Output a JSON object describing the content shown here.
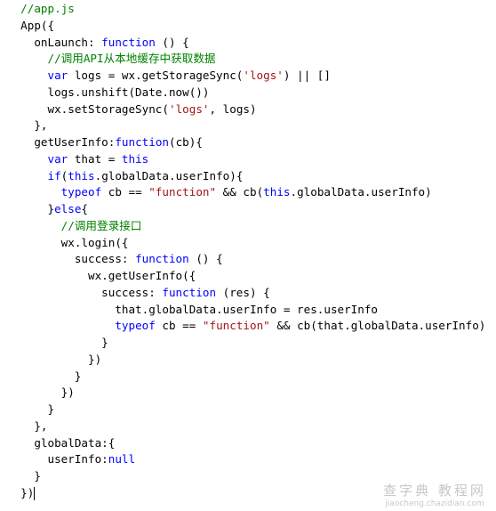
{
  "colors": {
    "keyword": "#0000ff",
    "string": "#a31515",
    "comment": "#008000",
    "plain": "#000000"
  },
  "code_lines": [
    [
      [
        "cm",
        "  //app.js"
      ]
    ],
    [
      [
        "pl",
        "  App({"
      ]
    ],
    [
      [
        "pl",
        "    onLaunch: "
      ],
      [
        "kw",
        "function"
      ],
      [
        "pl",
        " () {"
      ]
    ],
    [
      [
        "cm",
        "      //调用API从本地缓存中获取数据"
      ]
    ],
    [
      [
        "pl",
        "      "
      ],
      [
        "kw",
        "var"
      ],
      [
        "pl",
        " logs = wx.getStorageSync("
      ],
      [
        "str",
        "'logs'"
      ],
      [
        "pl",
        ") || []"
      ]
    ],
    [
      [
        "pl",
        "      logs.unshift(Date.now())"
      ]
    ],
    [
      [
        "pl",
        "      wx.setStorageSync("
      ],
      [
        "str",
        "'logs'"
      ],
      [
        "pl",
        ", logs)"
      ]
    ],
    [
      [
        "pl",
        "    },"
      ]
    ],
    [
      [
        "pl",
        "    getUserInfo:"
      ],
      [
        "kw",
        "function"
      ],
      [
        "pl",
        "(cb){"
      ]
    ],
    [
      [
        "pl",
        "      "
      ],
      [
        "kw",
        "var"
      ],
      [
        "pl",
        " that = "
      ],
      [
        "kw",
        "this"
      ]
    ],
    [
      [
        "pl",
        "      "
      ],
      [
        "kw",
        "if"
      ],
      [
        "pl",
        "("
      ],
      [
        "kw",
        "this"
      ],
      [
        "pl",
        ".globalData.userInfo){"
      ]
    ],
    [
      [
        "pl",
        "        "
      ],
      [
        "kw",
        "typeof"
      ],
      [
        "pl",
        " cb == "
      ],
      [
        "str",
        "\"function\""
      ],
      [
        "pl",
        " && cb("
      ],
      [
        "kw",
        "this"
      ],
      [
        "pl",
        ".globalData.userInfo)"
      ]
    ],
    [
      [
        "pl",
        "      }"
      ],
      [
        "kw",
        "else"
      ],
      [
        "pl",
        "{"
      ]
    ],
    [
      [
        "cm",
        "        //调用登录接口"
      ]
    ],
    [
      [
        "pl",
        "        wx.login({"
      ]
    ],
    [
      [
        "pl",
        "          success: "
      ],
      [
        "kw",
        "function"
      ],
      [
        "pl",
        " () {"
      ]
    ],
    [
      [
        "pl",
        "            wx.getUserInfo({"
      ]
    ],
    [
      [
        "pl",
        "              success: "
      ],
      [
        "kw",
        "function"
      ],
      [
        "pl",
        " (res) {"
      ]
    ],
    [
      [
        "pl",
        "                that.globalData.userInfo = res.userInfo"
      ]
    ],
    [
      [
        "pl",
        "                "
      ],
      [
        "kw",
        "typeof"
      ],
      [
        "pl",
        " cb == "
      ],
      [
        "str",
        "\"function\""
      ],
      [
        "pl",
        " && cb(that.globalData.userInfo)"
      ]
    ],
    [
      [
        "pl",
        "              }"
      ]
    ],
    [
      [
        "pl",
        "            })"
      ]
    ],
    [
      [
        "pl",
        "          }"
      ]
    ],
    [
      [
        "pl",
        "        })"
      ]
    ],
    [
      [
        "pl",
        "      }"
      ]
    ],
    [
      [
        "pl",
        "    },"
      ]
    ],
    [
      [
        "pl",
        "    globalData:{"
      ]
    ],
    [
      [
        "pl",
        "      userInfo:"
      ],
      [
        "kw",
        "null"
      ]
    ],
    [
      [
        "pl",
        "    }"
      ]
    ],
    [
      [
        "pl",
        "  })"
      ]
    ]
  ],
  "watermark": {
    "title": "查字典 教程网",
    "url": "jiaocheng.chazidian.com"
  }
}
